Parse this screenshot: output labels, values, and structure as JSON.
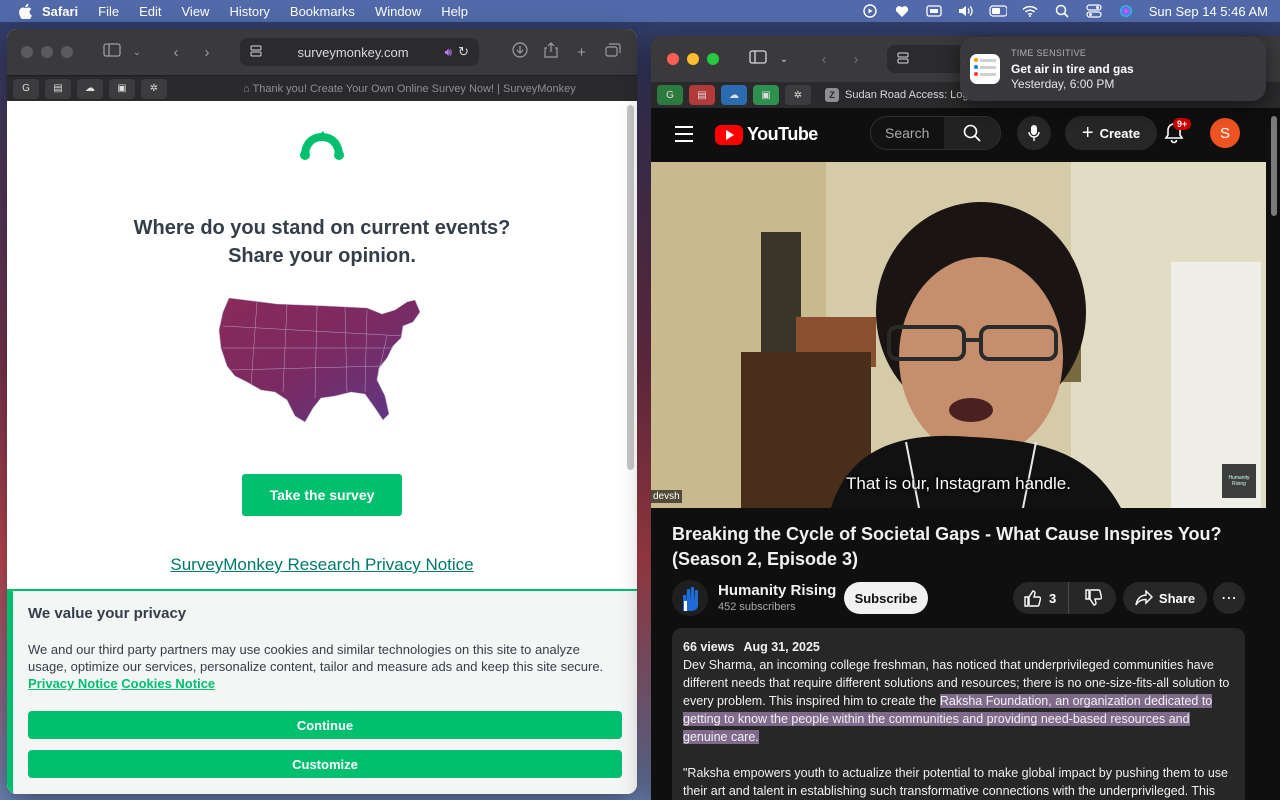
{
  "menubar": {
    "app_name": "Safari",
    "items": [
      "File",
      "Edit",
      "View",
      "History",
      "Bookmarks",
      "Window",
      "Help"
    ],
    "clock": "Sun Sep 14  5:46 AM",
    "bg_color": "#566eb0"
  },
  "left_window": {
    "address": "surveymonkey.com",
    "tab_title": "Thank you! Create Your Own Online Survey Now! | SurveyMonkey",
    "page": {
      "heading_line1": "Where do you stand on current events?",
      "heading_line2": "Share your opinion.",
      "cta_label": "Take the survey",
      "privacy_link": "SurveyMonkey Research Privacy Notice",
      "brand_color": "#00bf6f"
    },
    "cookie_banner": {
      "title": "We value your privacy",
      "body": "We and our third party partners may use cookies and similar technologies on this site to analyze usage, optimize our services, personalize content, tailor and measure ads and keep this site secure.",
      "privacy_link": "Privacy Notice",
      "cookies_link": "Cookies Notice",
      "continue_label": "Continue",
      "customize_label": "Customize"
    }
  },
  "right_window": {
    "address": "y",
    "tab_title": "Sudan Road Access: Log",
    "tab_favicon": "Z",
    "youtube": {
      "logo_text": "YouTube",
      "search_placeholder": "Search",
      "create_label": "Create",
      "notification_badge": "9+",
      "avatar_letter": "S",
      "subtitle": "That is our, Instagram handle.",
      "video_tag": "devsh",
      "watermark_text": "Humanity Rising",
      "title": "Breaking the Cycle of Societal Gaps - What Cause Inspires You? (Season 2, Episode 3)",
      "channel_name": "Humanity Rising",
      "subscribers": "452 subscribers",
      "subscribe_label": "Subscribe",
      "like_count": "3",
      "share_label": "Share",
      "description": {
        "views": "66 views",
        "date": "Aug 31, 2025",
        "para1_plain": "Dev Sharma, an incoming college freshman, has noticed that underprivileged communities have different needs that require different solutions and resources; there is no one-size-fits-all solution to every problem. This inspired him to create the ",
        "para1_highlight": "Raksha Foundation, an organization dedicated to getting to know the people within the communities and providing need-based resources and genuine care.",
        "para2": "\"Raksha empowers youth to actualize their potential to make global impact by pushing them to use their art and talent in establishing such transformative connections with the underprivileged. This"
      }
    }
  },
  "notification": {
    "tag": "TIME SENSITIVE",
    "title": "Get air in tire and gas",
    "time": "Yesterday, 6:00 PM"
  }
}
